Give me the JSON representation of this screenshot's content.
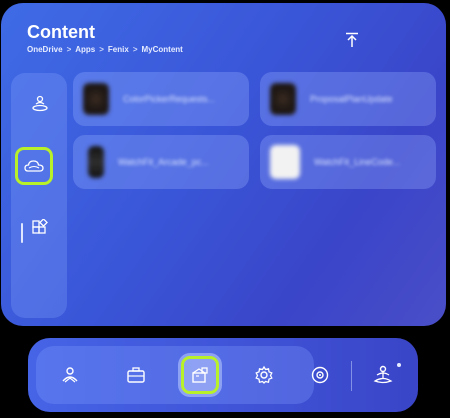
{
  "header": {
    "title": "Content",
    "breadcrumb": [
      "OneDrive",
      "Apps",
      "Fenix",
      "MyContent"
    ],
    "separator": ">"
  },
  "sidebar": {
    "items": [
      {
        "name": "home",
        "icon": "person-float-icon"
      },
      {
        "name": "onedrive",
        "icon": "cloud-icon",
        "selected": true
      },
      {
        "name": "apps",
        "icon": "apps-icon"
      }
    ]
  },
  "files": [
    {
      "name": "ColorPickerRequests...",
      "thumb": "dark"
    },
    {
      "name": "ProposalPlanUpdate",
      "thumb": "dark"
    },
    {
      "name": "WatchFit_Arcade_pc...",
      "thumb": "watch"
    },
    {
      "name": "WatchFit_LineCode...",
      "thumb": "white"
    }
  ],
  "taskbar": {
    "items": [
      "person-icon",
      "briefcase-icon",
      "content-icon",
      "settings-icon",
      "target-icon",
      "meditate-icon"
    ],
    "selected": "content-icon"
  },
  "colors": {
    "accent": "#b8f02a",
    "panel": "#3a56d8"
  }
}
